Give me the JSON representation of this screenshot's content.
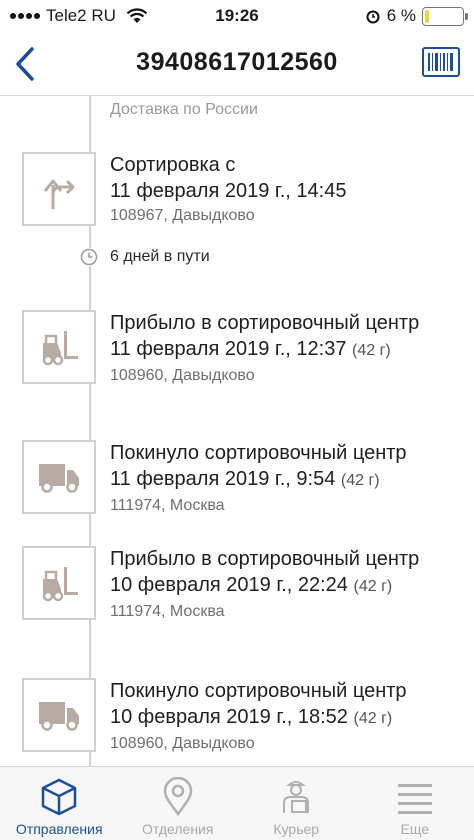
{
  "status_bar": {
    "carrier": "Tele2 RU",
    "time": "19:26",
    "battery_percent": "6 %",
    "battery_level": 0.06
  },
  "header": {
    "title": "39408617012560"
  },
  "timeline": {
    "section": "Доставка по России",
    "transit_note": "6 дней в пути",
    "events": [
      {
        "icon": "arrow-turn-icon",
        "title": "Сортировка с",
        "date": "11 февраля 2019 г., 14:45",
        "weight": "",
        "address": "108967, Давыдково"
      },
      {
        "icon": "forklift-icon",
        "title": "Прибыло в сортировочный центр",
        "date": "11 февраля 2019 г., 12:37",
        "weight": "(42 г)",
        "address": "108960, Давыдково"
      },
      {
        "icon": "truck-icon",
        "title": "Покинуло сортировочный центр",
        "date": "11 февраля 2019 г., 9:54",
        "weight": "(42 г)",
        "address": "111974, Москва"
      },
      {
        "icon": "forklift-icon",
        "title": "Прибыло в сортировочный центр",
        "date": "10 февраля 2019 г., 22:24",
        "weight": "(42 г)",
        "address": "111974, Москва"
      },
      {
        "icon": "truck-icon",
        "title": "Покинуло сортировочный центр",
        "date": "10 февраля 2019 г., 18:52",
        "weight": "(42 г)",
        "address": "108960, Давыдково"
      }
    ]
  },
  "tabbar": {
    "tabs": [
      {
        "label": "Отправления",
        "icon": "box-icon",
        "active": true
      },
      {
        "label": "Отделения",
        "icon": "map-pin-icon",
        "active": false
      },
      {
        "label": "Курьер",
        "icon": "courier-icon",
        "active": false
      },
      {
        "label": "Еще",
        "icon": "menu-icon",
        "active": false
      }
    ]
  },
  "colors": {
    "accent": "#1b4f9c",
    "icon_fill": "#b7aba3",
    "inactive": "#a8a8a8"
  }
}
